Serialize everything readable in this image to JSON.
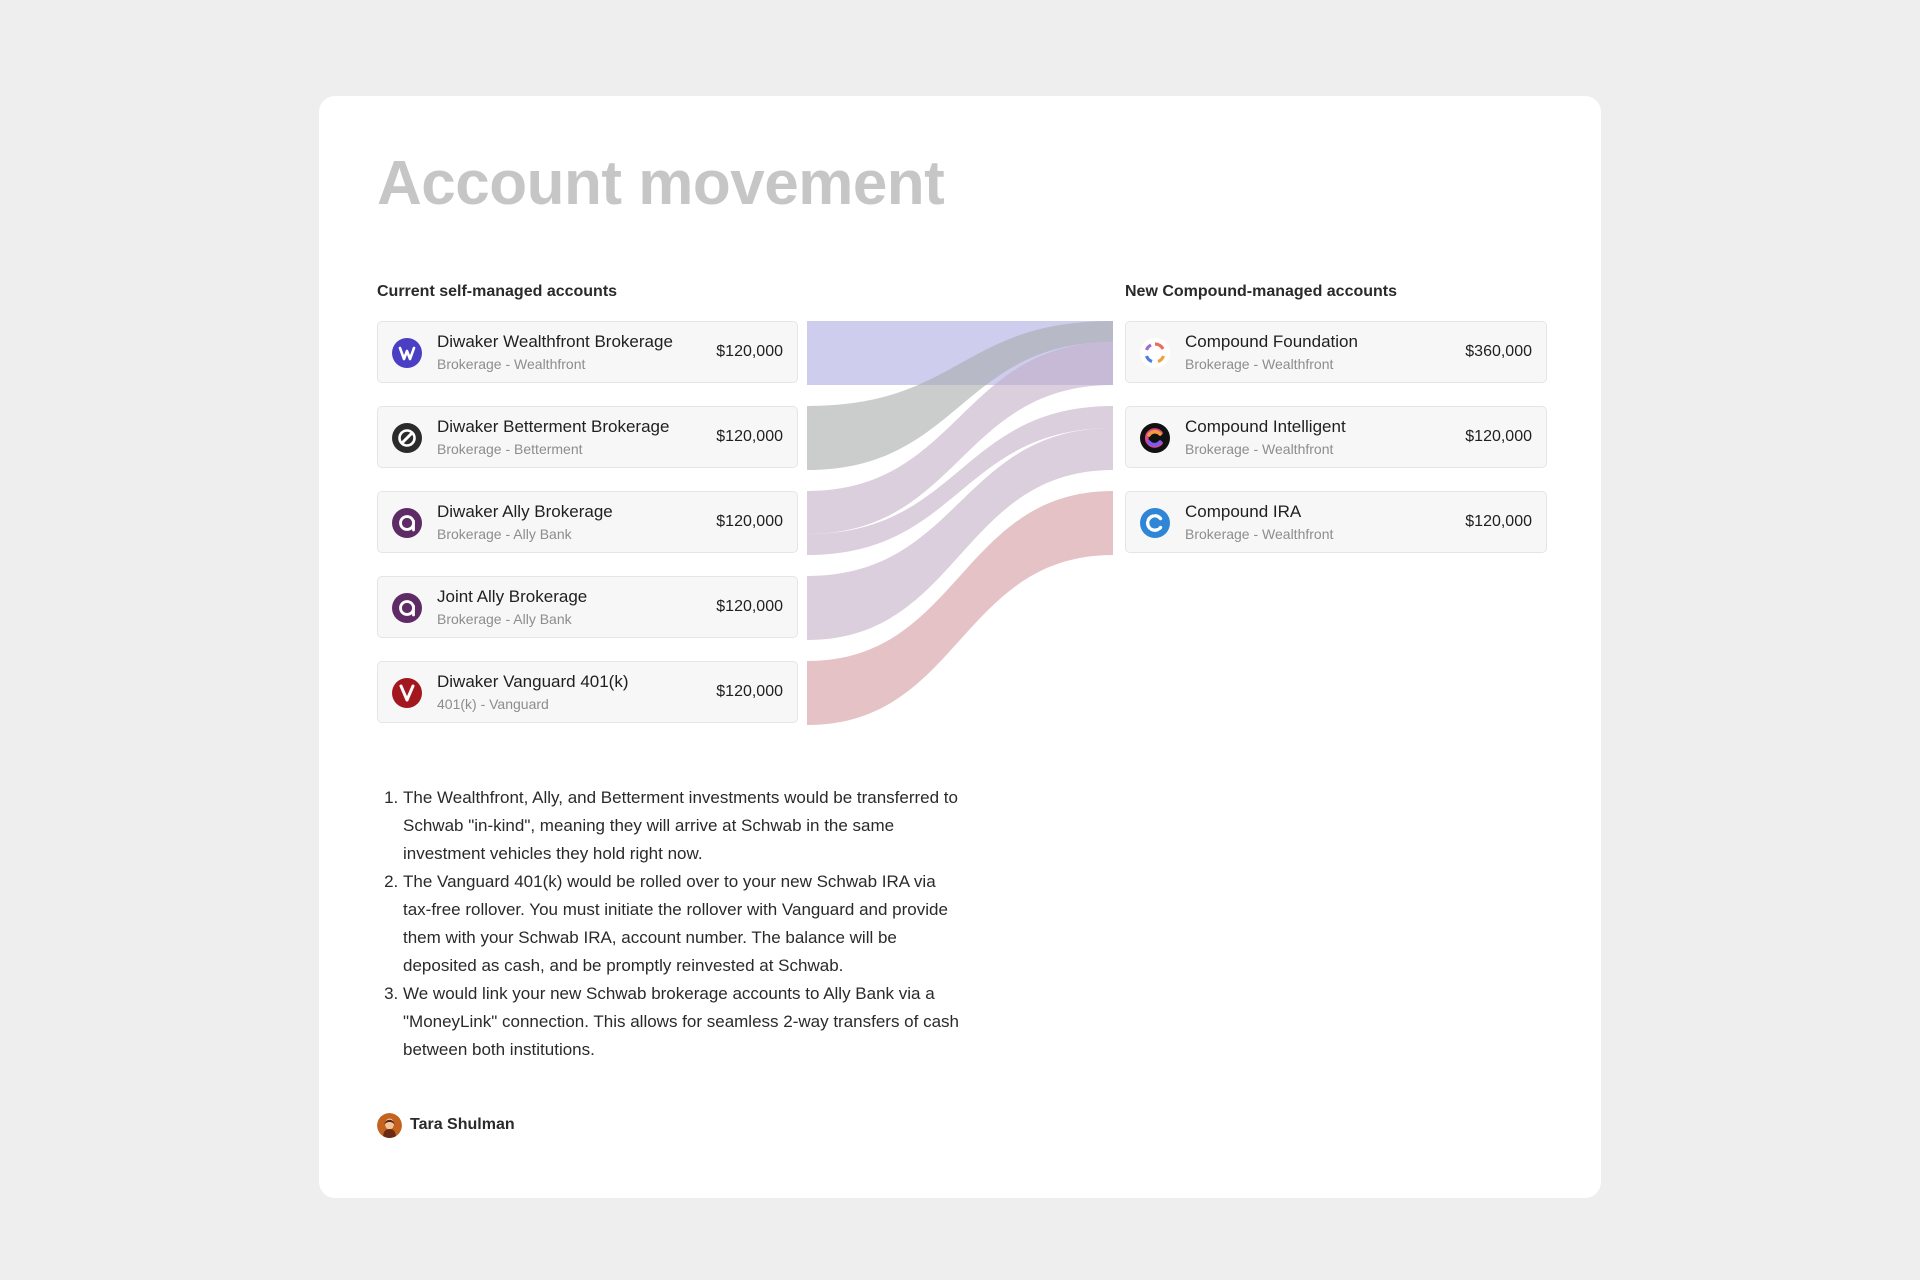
{
  "page": {
    "title": "Account movement"
  },
  "current_accounts": {
    "label": "Current self-managed accounts",
    "items": [
      {
        "name": "Diwaker Wealthfront Brokerage",
        "subtitle": "Brokerage - Wealthfront",
        "amount": "$120,000",
        "icon": "wealthfront-logo-icon",
        "color": "#4a3ec4"
      },
      {
        "name": "Diwaker Betterment Brokerage",
        "subtitle": "Brokerage - Betterment",
        "amount": "$120,000",
        "icon": "betterment-logo-icon",
        "color": "#2b2b2b"
      },
      {
        "name": "Diwaker Ally Brokerage",
        "subtitle": "Brokerage - Ally Bank",
        "amount": "$120,000",
        "icon": "ally-logo-icon",
        "color": "#5e2b66"
      },
      {
        "name": "Joint Ally Brokerage",
        "subtitle": "Brokerage - Ally Bank",
        "amount": "$120,000",
        "icon": "ally-logo-icon",
        "color": "#5e2b66"
      },
      {
        "name": "Diwaker Vanguard 401(k)",
        "subtitle": "401(k) - Vanguard",
        "amount": "$120,000",
        "icon": "vanguard-logo-icon",
        "color": "#a3171e"
      }
    ]
  },
  "new_accounts": {
    "label": "New Compound-managed accounts",
    "items": [
      {
        "name": "Compound Foundation",
        "subtitle": "Brokerage - Wealthfront",
        "amount": "$360,000",
        "icon": "compound-foundation-logo-icon"
      },
      {
        "name": "Compound Intelligent",
        "subtitle": "Brokerage - Wealthfront",
        "amount": "$120,000",
        "icon": "compound-intelligent-logo-icon"
      },
      {
        "name": "Compound IRA",
        "subtitle": "Brokerage - Wealthfront",
        "amount": "$120,000",
        "icon": "compound-ira-logo-icon"
      }
    ]
  },
  "flows": [
    {
      "from": "Diwaker Wealthfront Brokerage",
      "to": "Compound Foundation",
      "color": "#b9b8e6"
    },
    {
      "from": "Diwaker Betterment Brokerage",
      "to": "Compound Foundation",
      "color": "#a9abab"
    },
    {
      "from": "Diwaker Ally Brokerage",
      "to": "Compound Foundation",
      "color": "#c3aec6"
    },
    {
      "from": "Diwaker Ally Brokerage",
      "to": "Compound Intelligent",
      "color": "#c3aec6"
    },
    {
      "from": "Joint Ally Brokerage",
      "to": "Compound Intelligent",
      "color": "#c3aec6"
    },
    {
      "from": "Diwaker Vanguard 401(k)",
      "to": "Compound IRA",
      "color": "#d8a8ad"
    }
  ],
  "notes": [
    "The Wealthfront, Ally, and Betterment investments would be transferred to Schwab \"in-kind\", meaning they will arrive at Schwab in the same investment vehicles they hold right now.",
    "The Vanguard 401(k) would be rolled over to your new Schwab IRA via tax-free rollover. You must initiate the rollover with Vanguard and provide them with your Schwab IRA, account number. The balance will be deposited as cash, and be promptly reinvested at Schwab.",
    "We would link your new Schwab brokerage accounts to Ally Bank via a \"MoneyLink\" connection. This allows for seamless 2-way transfers of cash between both institutions."
  ],
  "author": {
    "name": "Tara Shulman",
    "icon": "avatar"
  }
}
